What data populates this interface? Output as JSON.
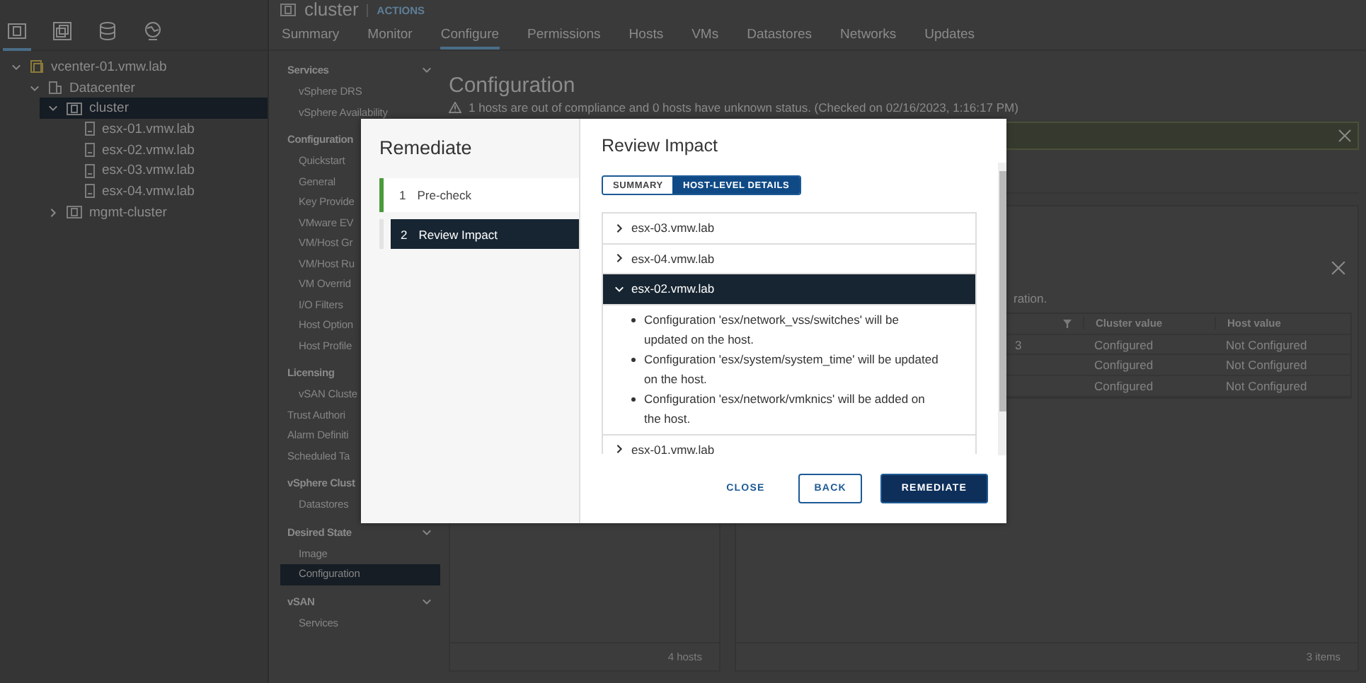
{
  "tree_tabs": [
    {
      "kind": "hosts",
      "selected": true
    },
    {
      "kind": "vms",
      "selected": false
    },
    {
      "kind": "storage",
      "selected": false
    },
    {
      "kind": "network",
      "selected": false
    }
  ],
  "tree": [
    {
      "label": "vcenter-01.vmw.lab",
      "kind": "vcenter",
      "expanded": true,
      "selected": false,
      "children": [
        {
          "label": "Datacenter",
          "kind": "datacenter",
          "expanded": true,
          "selected": false,
          "children": [
            {
              "label": "cluster",
              "kind": "cluster",
              "expanded": true,
              "selected": true,
              "children": [
                {
                  "label": "esx-01.vmw.lab",
                  "kind": "host",
                  "selected": false
                },
                {
                  "label": "esx-02.vmw.lab",
                  "kind": "host",
                  "selected": false
                },
                {
                  "label": "esx-03.vmw.lab",
                  "kind": "host",
                  "selected": false
                },
                {
                  "label": "esx-04.vmw.lab",
                  "kind": "host",
                  "selected": false
                }
              ]
            },
            {
              "label": "mgmt-cluster",
              "kind": "cluster",
              "expanded": false,
              "selected": false
            }
          ]
        }
      ]
    }
  ],
  "object": {
    "title": "cluster",
    "actions": "ACTIONS"
  },
  "tabs": [
    {
      "label": "Summary",
      "selected": false
    },
    {
      "label": "Monitor",
      "selected": false
    },
    {
      "label": "Configure",
      "selected": true
    },
    {
      "label": "Permissions",
      "selected": false
    },
    {
      "label": "Hosts",
      "selected": false
    },
    {
      "label": "VMs",
      "selected": false
    },
    {
      "label": "Datastores",
      "selected": false
    },
    {
      "label": "Networks",
      "selected": false
    },
    {
      "label": "Updates",
      "selected": false
    }
  ],
  "config_nav": [
    {
      "kind": "header",
      "label": "Services",
      "expanded": true
    },
    {
      "kind": "item",
      "label": "vSphere DRS",
      "selected": false
    },
    {
      "kind": "item",
      "label": "vSphere Availability",
      "selected": false
    },
    {
      "kind": "header",
      "label": "Configuration"
    },
    {
      "kind": "item",
      "label": "Quickstart",
      "selected": false
    },
    {
      "kind": "item",
      "label": "General",
      "selected": false
    },
    {
      "kind": "item",
      "label": "Key Provide",
      "selected": false
    },
    {
      "kind": "item",
      "label": "VMware EV",
      "selected": false
    },
    {
      "kind": "item",
      "label": "VM/Host Gr",
      "selected": false
    },
    {
      "kind": "item",
      "label": "VM/Host Ru",
      "selected": false
    },
    {
      "kind": "item",
      "label": "VM Overrid",
      "selected": false
    },
    {
      "kind": "item",
      "label": "I/O Filters",
      "selected": false
    },
    {
      "kind": "item",
      "label": "Host Option",
      "selected": false
    },
    {
      "kind": "item",
      "label": "Host Profile",
      "selected": false
    },
    {
      "kind": "header",
      "label": "Licensing"
    },
    {
      "kind": "item",
      "label": "vSAN Cluste",
      "selected": false
    },
    {
      "kind": "link",
      "label": "Trust Authori",
      "selected": false
    },
    {
      "kind": "link",
      "label": "Alarm Definiti",
      "selected": false
    },
    {
      "kind": "link",
      "label": "Scheduled Ta",
      "selected": false
    },
    {
      "kind": "header",
      "label": "vSphere Clust"
    },
    {
      "kind": "item",
      "label": "Datastores",
      "selected": false
    },
    {
      "kind": "header",
      "label": "Desired State",
      "expanded": true
    },
    {
      "kind": "item",
      "label": "Image",
      "selected": false
    },
    {
      "kind": "item",
      "label": "Configuration",
      "selected": true
    },
    {
      "kind": "header",
      "label": "vSAN",
      "expanded": true
    },
    {
      "kind": "item",
      "label": "Services",
      "selected": false
    }
  ],
  "content": {
    "title": "Configuration",
    "warning": "1 hosts are out of compliance and 0 hosts have unknown status. (Checked on 02/16/2023, 1:16:17 PM)",
    "hosts_panel": {
      "footer": "4 hosts"
    },
    "details_panel": {
      "description": "ration.",
      "columns": [
        "Cluster value",
        "Host value"
      ],
      "rows": [
        {
          "column_1": "3",
          "cluster_value": "Configured",
          "host_value": "Not Configured"
        },
        {
          "cluster_value": "Configured",
          "host_value": "Not Configured"
        },
        {
          "cluster_value": "Configured",
          "host_value": "Not Configured"
        }
      ],
      "footer": "3 items"
    }
  },
  "dialog": {
    "title": "Remediate",
    "steps": [
      {
        "number": "1",
        "label": "Pre-check",
        "selected": false,
        "completed": true
      },
      {
        "number": "2",
        "label": "Review Impact",
        "selected": true,
        "completed": false
      }
    ],
    "heading": "Review Impact",
    "views": [
      {
        "label": "SUMMARY",
        "selected": false
      },
      {
        "label": "HOST-LEVEL DETAILS",
        "selected": true
      }
    ],
    "hosts": [
      {
        "name": "esx-03.vmw.lab",
        "expanded": false
      },
      {
        "name": "esx-04.vmw.lab",
        "expanded": false
      },
      {
        "name": "esx-02.vmw.lab",
        "expanded": true,
        "changes": [
          "Configuration 'esx/network_vss/switches' will be updated on the host.",
          "Configuration 'esx/system/system_time' will be updated on the host.",
          "Configuration 'esx/network/vmknics' will be added on the host."
        ]
      },
      {
        "name": "esx-01.vmw.lab",
        "expanded": false
      }
    ],
    "buttons": [
      {
        "label": "CLOSE",
        "kind": "link"
      },
      {
        "label": "BACK",
        "kind": "outline"
      },
      {
        "label": "REMEDIATE",
        "kind": "primary"
      }
    ]
  }
}
